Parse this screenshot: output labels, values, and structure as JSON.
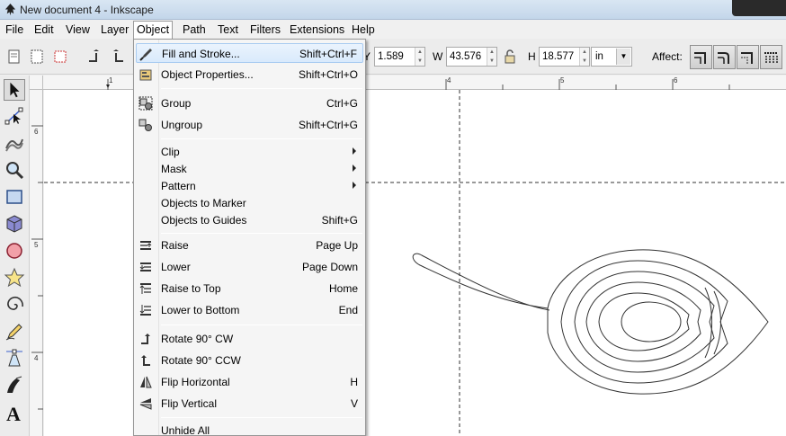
{
  "window": {
    "title": "New document 4 - Inkscape"
  },
  "menubar": {
    "items": [
      "File",
      "Edit",
      "View",
      "Layer",
      "Object",
      "Path",
      "Text",
      "Filters",
      "Extensions",
      "Help"
    ],
    "active": "Object"
  },
  "toolbar": {
    "y_value": "1.589",
    "w_label": "W",
    "w_value": "43.576",
    "h_label": "H",
    "h_value": "18.577",
    "unit": "in",
    "affect_label": "Affect:"
  },
  "ruler": {
    "h_ticks": [
      "1",
      "4",
      "5",
      "6"
    ],
    "v_ticks": [
      "6",
      "5",
      "4"
    ]
  },
  "object_menu": {
    "items": [
      {
        "label": "Fill and Stroke...",
        "shortcut": "Shift+Ctrl+F",
        "icon": "fill-stroke-icon",
        "highlight": true
      },
      {
        "label": "Object Properties...",
        "shortcut": "Shift+Ctrl+O",
        "icon": "object-properties-icon"
      },
      {
        "label": "Group",
        "shortcut": "Ctrl+G",
        "icon": "group-icon"
      },
      {
        "label": "Ungroup",
        "shortcut": "Shift+Ctrl+G",
        "icon": "ungroup-icon"
      },
      {
        "label": "Clip",
        "shortcut": "",
        "submenu": true
      },
      {
        "label": "Mask",
        "shortcut": "",
        "submenu": true
      },
      {
        "label": "Pattern",
        "shortcut": "",
        "submenu": true
      },
      {
        "label": "Objects to Marker",
        "shortcut": ""
      },
      {
        "label": "Objects to Guides",
        "shortcut": "Shift+G"
      },
      {
        "label": "Raise",
        "shortcut": "Page Up",
        "icon": "raise-icon"
      },
      {
        "label": "Lower",
        "shortcut": "Page Down",
        "icon": "lower-icon"
      },
      {
        "label": "Raise to Top",
        "shortcut": "Home",
        "icon": "raise-to-top-icon"
      },
      {
        "label": "Lower to Bottom",
        "shortcut": "End",
        "icon": "lower-to-bottom-icon"
      },
      {
        "label": "Rotate 90° CW",
        "shortcut": "",
        "icon": "rotate-cw-icon"
      },
      {
        "label": "Rotate 90° CCW",
        "shortcut": "",
        "icon": "rotate-ccw-icon"
      },
      {
        "label": "Flip Horizontal",
        "shortcut": "H",
        "icon": "flip-horizontal-icon"
      },
      {
        "label": "Flip Vertical",
        "shortcut": "V",
        "icon": "flip-vertical-icon"
      },
      {
        "label": "Unhide All",
        "shortcut": ""
      }
    ]
  },
  "colors": {
    "menu_highlight": "#d9eafc",
    "canvas": "#ffffff",
    "guide": "#333333"
  }
}
